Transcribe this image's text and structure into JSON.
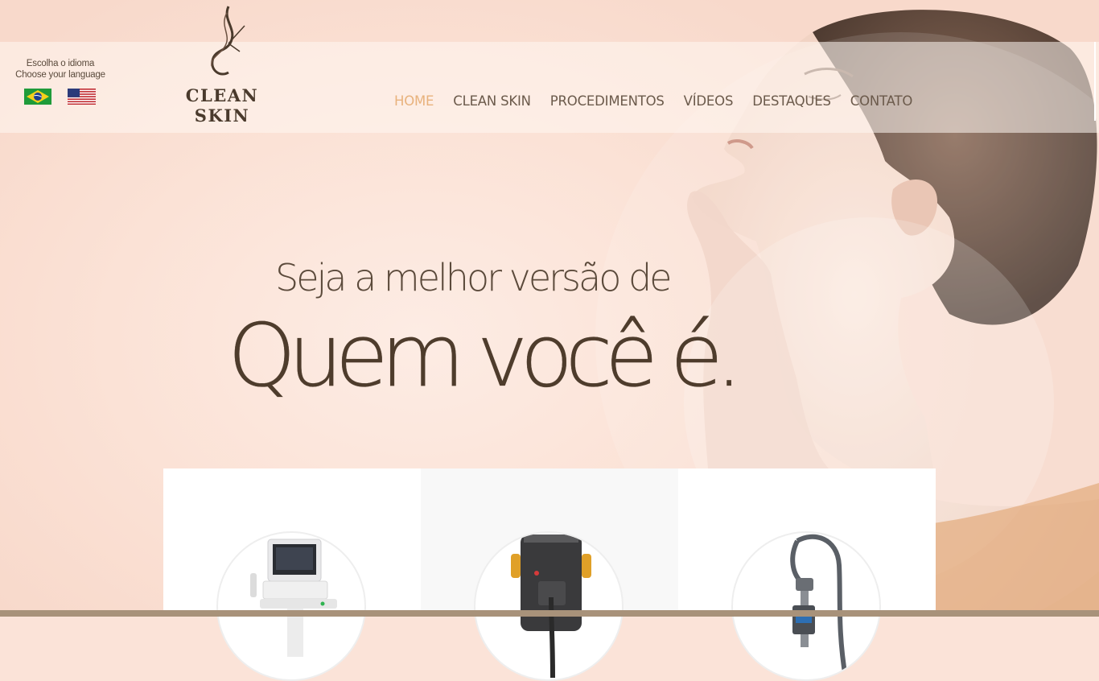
{
  "language": {
    "label_pt": "Escolha o idioma",
    "label_en": "Choose your language",
    "flags": [
      "brazil-flag-icon",
      "usa-flag-icon"
    ]
  },
  "brand": {
    "name": "CLEAN SKIN"
  },
  "nav": {
    "items": [
      {
        "label": "HOME",
        "active": true
      },
      {
        "label": "CLEAN SKIN",
        "active": false
      },
      {
        "label": "PROCEDIMENTOS",
        "active": false
      },
      {
        "label": "VÍDEOS",
        "active": false
      },
      {
        "label": "DESTAQUES",
        "active": false
      },
      {
        "label": "CONTATO",
        "active": false
      }
    ]
  },
  "hero": {
    "line1": "Seja a melhor versão de",
    "line2": "Quem você é."
  },
  "cards": [
    {
      "icon": "ultrasound-device-icon"
    },
    {
      "icon": "laser-device-icon"
    },
    {
      "icon": "vacuum-device-icon"
    }
  ],
  "colors": {
    "background": "#fbe3d8",
    "accent_active": "#e8b27c",
    "nav_text": "#6b5a4b",
    "headline": "#4e3c2c",
    "footer_strip": "#a8927a"
  }
}
